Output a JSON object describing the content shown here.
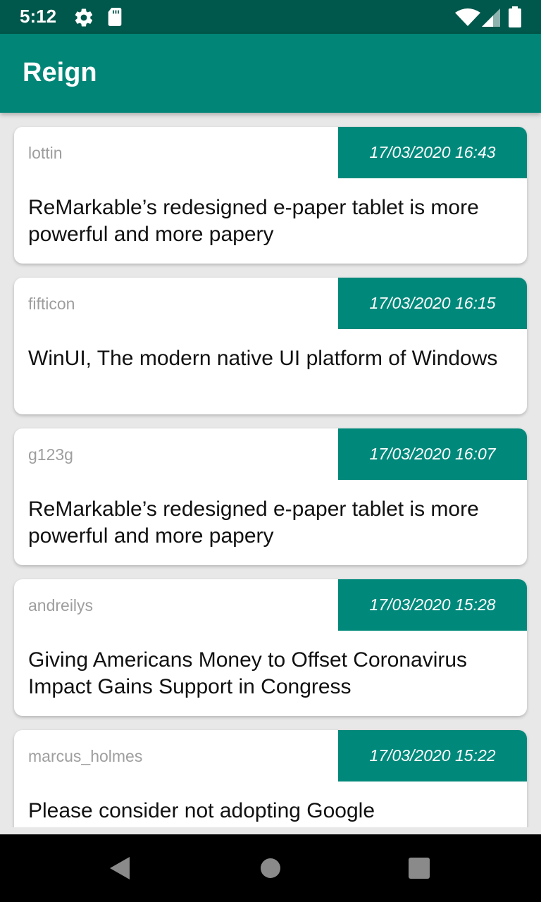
{
  "status_bar": {
    "time": "5:12",
    "icons": [
      "gear-icon",
      "sd-card-icon",
      "wifi-icon",
      "signal-icon",
      "battery-icon"
    ]
  },
  "app_bar": {
    "title": "Reign"
  },
  "colors": {
    "status_bar": "#00574b",
    "primary": "#008577",
    "date_badge": "#00897b",
    "background": "#e8e8e8",
    "author_text": "#9e9e9e"
  },
  "posts": [
    {
      "author": "lottin",
      "date": "17/03/2020 16:43",
      "title": "ReMarkable’s redesigned e-paper tablet is more powerful and more papery"
    },
    {
      "author": "fifticon",
      "date": "17/03/2020 16:15",
      "title": "WinUI, The modern native UI platform of Windows"
    },
    {
      "author": "g123g",
      "date": "17/03/2020 16:07",
      "title": "ReMarkable’s redesigned e-paper tablet is more powerful and more papery"
    },
    {
      "author": "andreilys",
      "date": "17/03/2020 15:28",
      "title": "Giving Americans Money to Offset Coronavirus Impact Gains Support in Congress"
    },
    {
      "author": "marcus_holmes",
      "date": "17/03/2020 15:22",
      "title": "Please consider not adopting Google"
    }
  ],
  "nav_bar": {
    "buttons": [
      "back-icon",
      "home-icon",
      "recents-icon"
    ]
  }
}
